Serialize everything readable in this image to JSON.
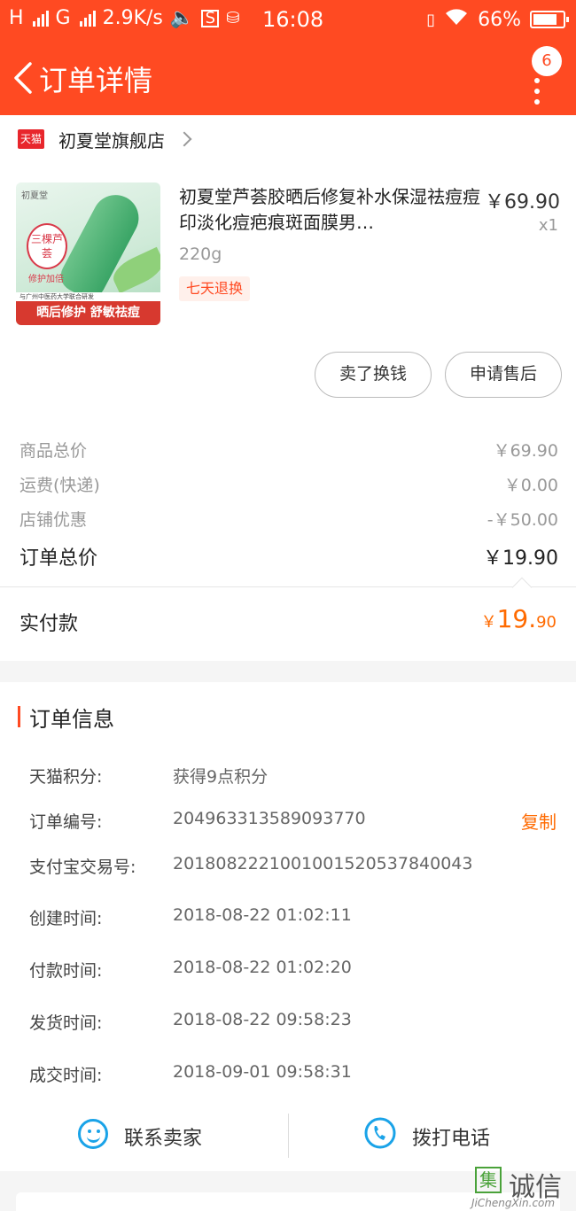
{
  "status_bar": {
    "network": "H",
    "network2": "G",
    "speed": "2.9K/s",
    "time": "16:08",
    "battery": "66%"
  },
  "header": {
    "title": "订单详情",
    "badge": "6"
  },
  "shop": {
    "logo": "天猫",
    "name": "初夏堂旗舰店"
  },
  "product": {
    "image": {
      "brand": "初夏堂",
      "circle_text": "三棵芦荟",
      "tag": "修护加倍",
      "sub": "与广州中医药大学联合研发",
      "strip": "晒后修护 舒敏祛痘"
    },
    "title": "初夏堂芦荟胶晒后修复补水保湿祛痘痘印淡化痘疤痕斑面膜男…",
    "price": "￥69.90",
    "qty": "x1",
    "sku": "220g",
    "tag": "七天退换"
  },
  "buttons": {
    "sell": "卖了换钱",
    "after_sale": "申请售后"
  },
  "summary": {
    "rows": [
      {
        "label": "商品总价",
        "value": "￥69.90"
      },
      {
        "label": "运费(快递)",
        "value": "￥0.00"
      },
      {
        "label": "店铺优惠",
        "value": "-￥50.00"
      }
    ],
    "total_label": "订单总价",
    "total_value": "￥19.90",
    "paid_label": "实付款",
    "paid_currency": "￥",
    "paid_int": "19.",
    "paid_dec": "90"
  },
  "info": {
    "title": "订单信息",
    "rows": [
      {
        "label": "天猫积分:",
        "value": "获得9点积分"
      },
      {
        "label": "订单编号:",
        "value": "204963313589093770"
      },
      {
        "label": "支付宝交易号:",
        "value": "2018082221001001520537840043"
      },
      {
        "label": "创建时间:",
        "value": "2018-08-22 01:02:11"
      },
      {
        "label": "付款时间:",
        "value": "2018-08-22 01:02:20"
      },
      {
        "label": "发货时间:",
        "value": "2018-08-22 09:58:23"
      },
      {
        "label": "成交时间:",
        "value": "2018-09-01 09:58:31"
      }
    ],
    "copy": "复制"
  },
  "actions": {
    "contact": "联系卖家",
    "call": "拨打电话"
  },
  "watermark": {
    "logo": "集",
    "cn": "诚信",
    "en": "JiChengXin.com"
  },
  "colors": {
    "primary": "#ff4a22",
    "price_accent": "#ff6a00",
    "icon_blue": "#1aa3e8"
  }
}
